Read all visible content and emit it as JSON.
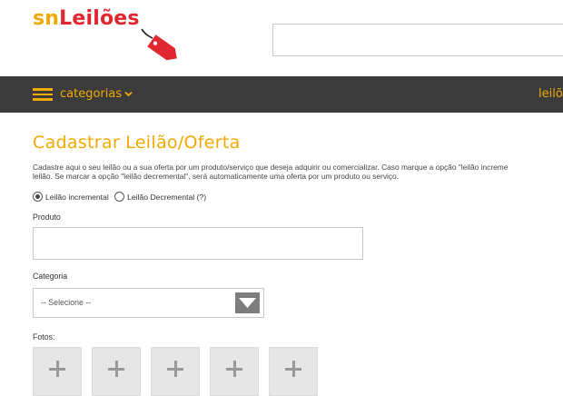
{
  "header": {
    "logo_sn": "sn",
    "logo_rest": "Leilões",
    "search": {
      "value": "",
      "placeholder": ""
    }
  },
  "nav": {
    "categories_label": "categorias",
    "right_label": "leilõ"
  },
  "page": {
    "title": "Cadastrar Leilão/Oferta",
    "description_line1": "Cadastre aqui o seu leilão ou a sua oferta por um produto/serviço que deseja adquirir ou comercializar. Caso marque a opção \"leilão increme",
    "description_line2": "leilão. Se marcar a opção \"leilão decremental\", será automaticamente uma oferta por um produto ou serviço."
  },
  "form": {
    "auction_type": {
      "options": [
        "Leilão incremental",
        "Leilão Decremental (?)"
      ],
      "selected": "Leilão incremental"
    },
    "produto": {
      "label": "Produto",
      "value": "",
      "placeholder": ""
    },
    "categoria": {
      "label": "Categoria",
      "selected": "-- Selecione --"
    },
    "fotos": {
      "label": "Fotos:",
      "slot_count": 5,
      "slot_icon": "plus-icon"
    }
  },
  "colors": {
    "brand_orange": "#f2a900",
    "brand_red": "#e0262e",
    "nav_bg": "#3b3b3b",
    "select_button": "#7d7d7d"
  },
  "icons": {
    "menu": "hamburger-menu-icon",
    "dropdown": "chevron-down-icon",
    "tag": "price-tag-icon",
    "select_arrow": "triangle-down-icon"
  }
}
